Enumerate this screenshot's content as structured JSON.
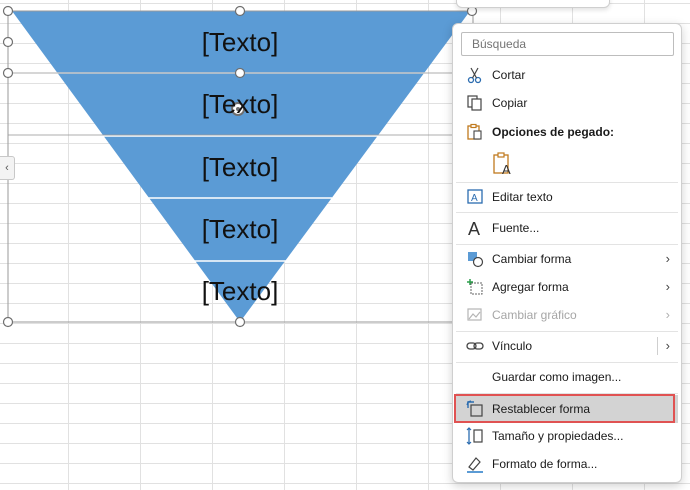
{
  "diagram": {
    "fill_color": "#5b9bd5",
    "segments": [
      "[Texto]",
      "[Texto]",
      "[Texto]",
      "[Texto]",
      "[Texto]"
    ]
  },
  "collapse_tab": {
    "glyph": "‹"
  },
  "context_menu": {
    "search_placeholder": "Búsqueda",
    "items": {
      "cut": "Cortar",
      "copy": "Copiar",
      "paste_options": "Opciones de pegado:",
      "edit_text": "Editar texto",
      "font": "Fuente...",
      "change_shape": "Cambiar forma",
      "add_shape": "Agregar forma",
      "change_graphic": "Cambiar gráfico",
      "link": "Vínculo",
      "save_as_image": "Guardar como imagen...",
      "reset_shape": "Restablecer forma",
      "size_properties": "Tamaño y propiedades...",
      "format_shape": "Formato de forma..."
    },
    "submenu_arrow": "›",
    "highlight_color": "#e05252"
  }
}
